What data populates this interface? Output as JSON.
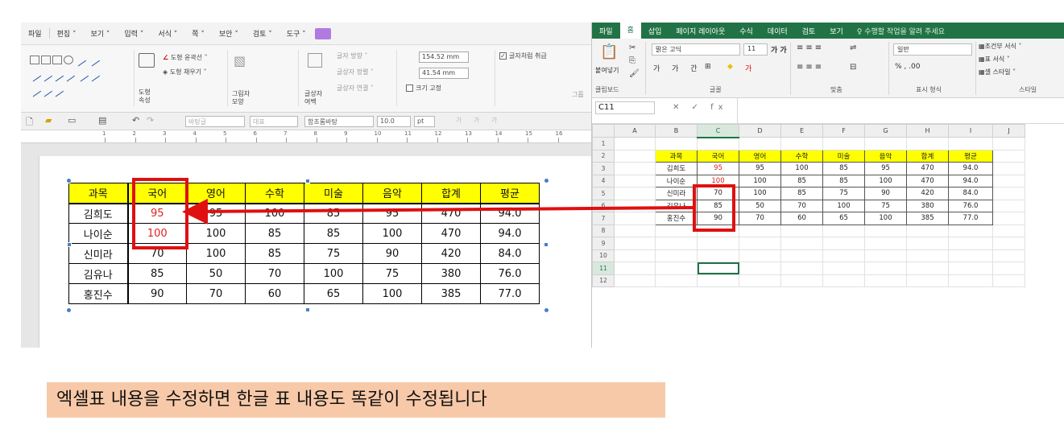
{
  "hwp": {
    "menu": [
      "파일",
      "편집 ˅",
      "보기 ˅",
      "입력 ˅",
      "서식 ˅",
      "쪽 ˅",
      "보안 ˅",
      "검토 ˅",
      "도구 ˅"
    ],
    "ribbon": {
      "outline_label": "도형 윤곽선 ˅",
      "fill_label": "도형 채우기 ˅",
      "shape_props": "도형\n속성",
      "shadow": "그림자\n모양",
      "text_dir": "글자 방향 ˅",
      "text_align": "글상자 정렬 ˅",
      "text_link": "글상자 연결 ˅",
      "glyph_box": "글상자\n여백",
      "width_value": "154.52",
      "height_value": "41.54",
      "unit": "mm",
      "fix_size": "크기 고정",
      "treat_as_char": "글자처럼 취급",
      "group": "그룹"
    },
    "toolbar": {
      "style": "바탕글",
      "outline": "대표",
      "font": "함초롬바탕",
      "size": "10.0",
      "unit": "pt"
    },
    "ruler_numbers": [
      "1",
      "2",
      "3",
      "4",
      "5",
      "6",
      "7",
      "8",
      "9",
      "10",
      "11",
      "12",
      "13",
      "14",
      "15",
      "16"
    ]
  },
  "table": {
    "headers": [
      "과목",
      "국어",
      "영어",
      "수학",
      "미술",
      "음악",
      "합계",
      "평균"
    ],
    "rows": [
      [
        "김희도",
        "95",
        "95",
        "100",
        "85",
        "95",
        "470",
        "94.0"
      ],
      [
        "나이순",
        "100",
        "100",
        "85",
        "85",
        "100",
        "470",
        "94.0"
      ],
      [
        "신미라",
        "70",
        "100",
        "85",
        "75",
        "90",
        "420",
        "84.0"
      ],
      [
        "김유나",
        "85",
        "50",
        "70",
        "100",
        "75",
        "380",
        "76.0"
      ],
      [
        "홍진수",
        "90",
        "70",
        "60",
        "65",
        "100",
        "385",
        "77.0"
      ]
    ]
  },
  "excel": {
    "menu": [
      "파일",
      "홈",
      "삽입",
      "페이지 레이아웃",
      "수식",
      "데이터",
      "검토",
      "보기"
    ],
    "tell_me": "♀ 수행할 작업을 알려 주세요",
    "ribbon": {
      "paste": "붙여넣기",
      "font_name": "맑은 고딕",
      "font_size": "11",
      "number_format": "일반",
      "cond_format": "조건부 서식 ˅",
      "table_format": "표 서식 ˅",
      "cell_style": "셀 스타일 ˅",
      "groups": [
        "클립보드",
        "글꼴",
        "맞춤",
        "표시 형식",
        "스타일"
      ]
    },
    "name_box": "C11",
    "fx": "✕ ✓ fx",
    "columns": [
      "A",
      "B",
      "C",
      "D",
      "E",
      "F",
      "G",
      "H",
      "I",
      "J"
    ],
    "row_numbers": [
      "1",
      "2",
      "3",
      "4",
      "5",
      "6",
      "7",
      "8",
      "9",
      "10",
      "11",
      "12"
    ]
  },
  "caption": "엑셀표 내용을 수정하면 한글 표 내용도 똑같이 수정됩니다",
  "colors": {
    "excel_green": "#217346",
    "highlight_yellow": "#ffff00",
    "red_marker": "#e01010",
    "caption_bg": "#f8c9a8"
  }
}
